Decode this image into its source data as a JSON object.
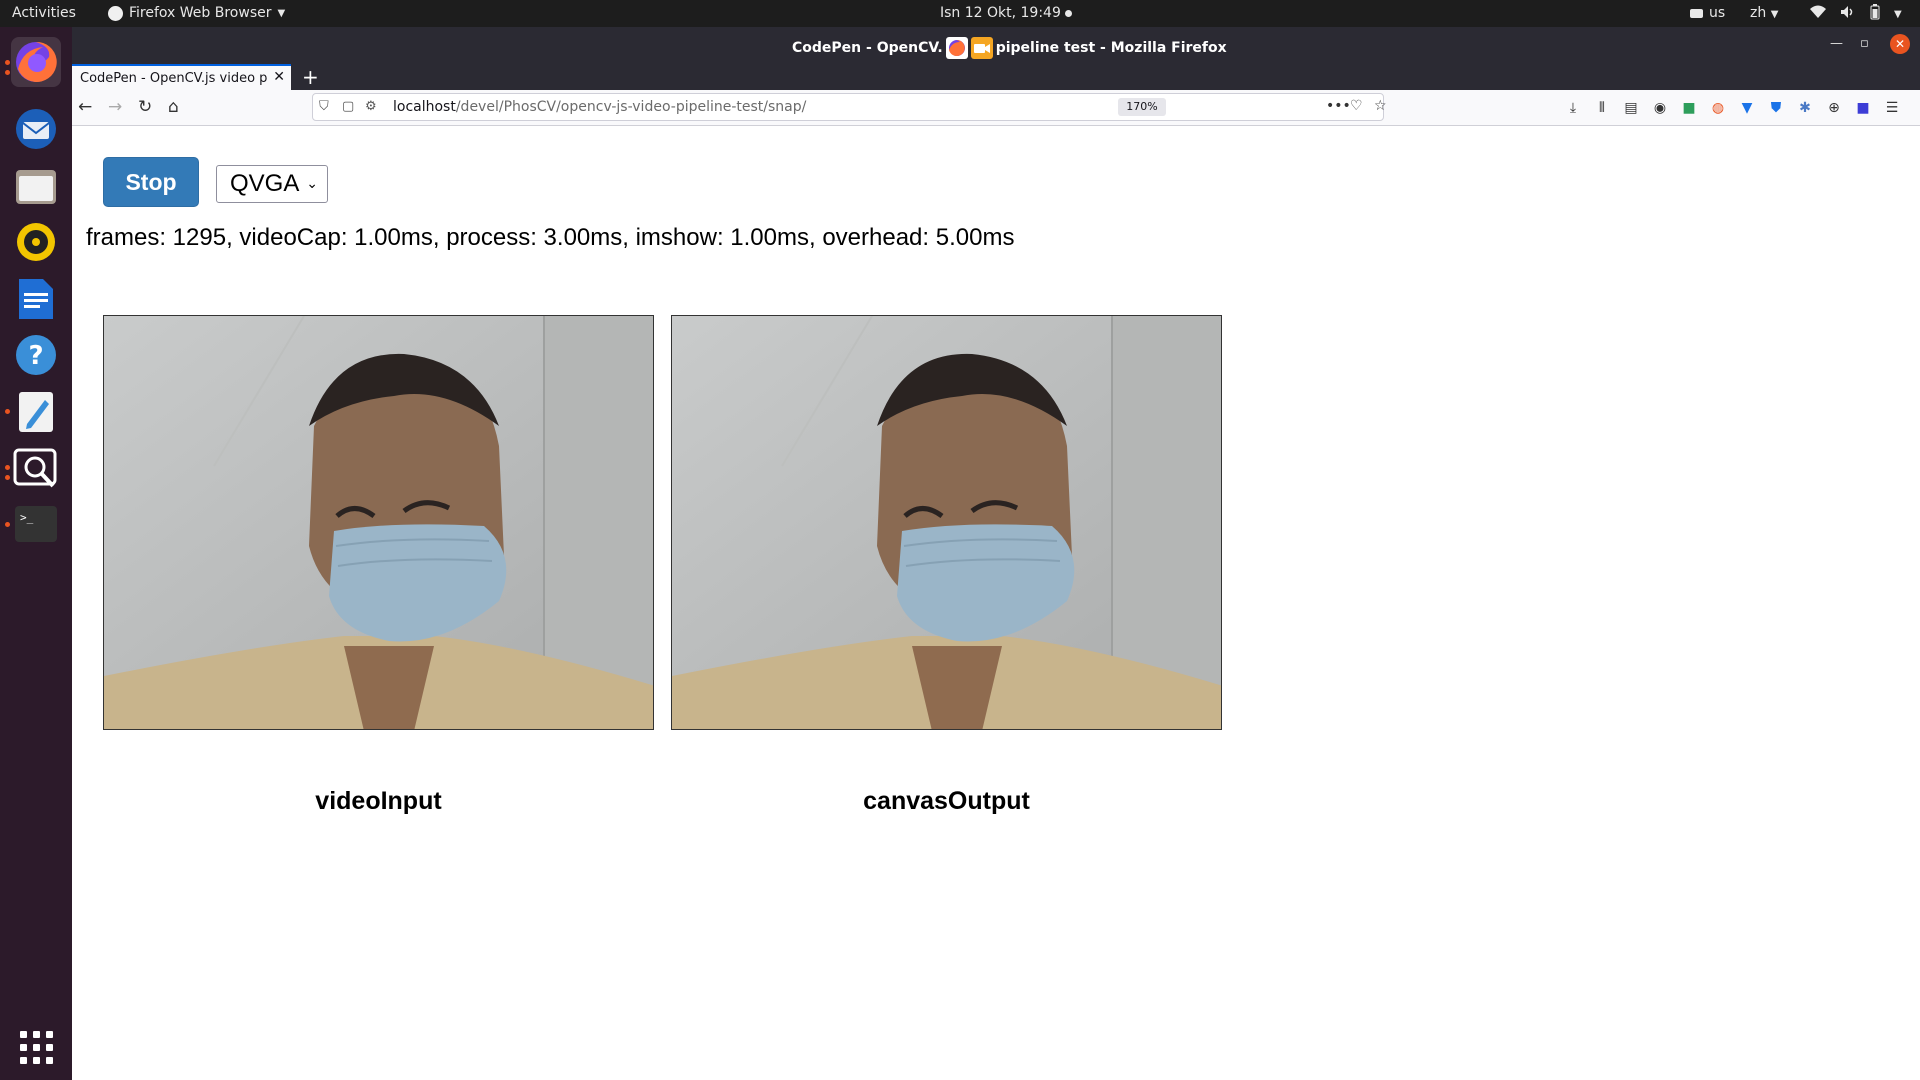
{
  "topbar": {
    "activities": "Activities",
    "app_name": "Firefox Web Browser",
    "clock": "Isn 12 Okt, 19:49",
    "kbd": "us",
    "lang": "zh"
  },
  "dock": {
    "apps": [
      "firefox",
      "thunderbird",
      "files",
      "rhythmbox",
      "writer",
      "help",
      "text-editor",
      "screenshot",
      "terminal",
      "show-apps"
    ]
  },
  "window": {
    "title_left": "CodePen - OpenCV.",
    "title_right": "pipeline test - Mozilla Firefox"
  },
  "tab": {
    "label": "CodePen - OpenCV.js video p",
    "close": "✕",
    "new": "+"
  },
  "urlbar": {
    "host": "localhost",
    "path": "/devel/PhosCV/opencv-js-video-pipeline-test/snap/",
    "zoom": "170%"
  },
  "page": {
    "stop_label": "Stop",
    "resolution": "QVGA",
    "stats": "frames: 1295, videoCap: 1.00ms, process: 3.00ms, imshow: 1.00ms, overhead: 5.00ms",
    "caption_input": "videoInput",
    "caption_output": "canvasOutput"
  },
  "colors": {
    "stop_button": "#337ab7",
    "dock_bg": "#2c1a2a",
    "ubuntu_orange": "#e95420"
  }
}
